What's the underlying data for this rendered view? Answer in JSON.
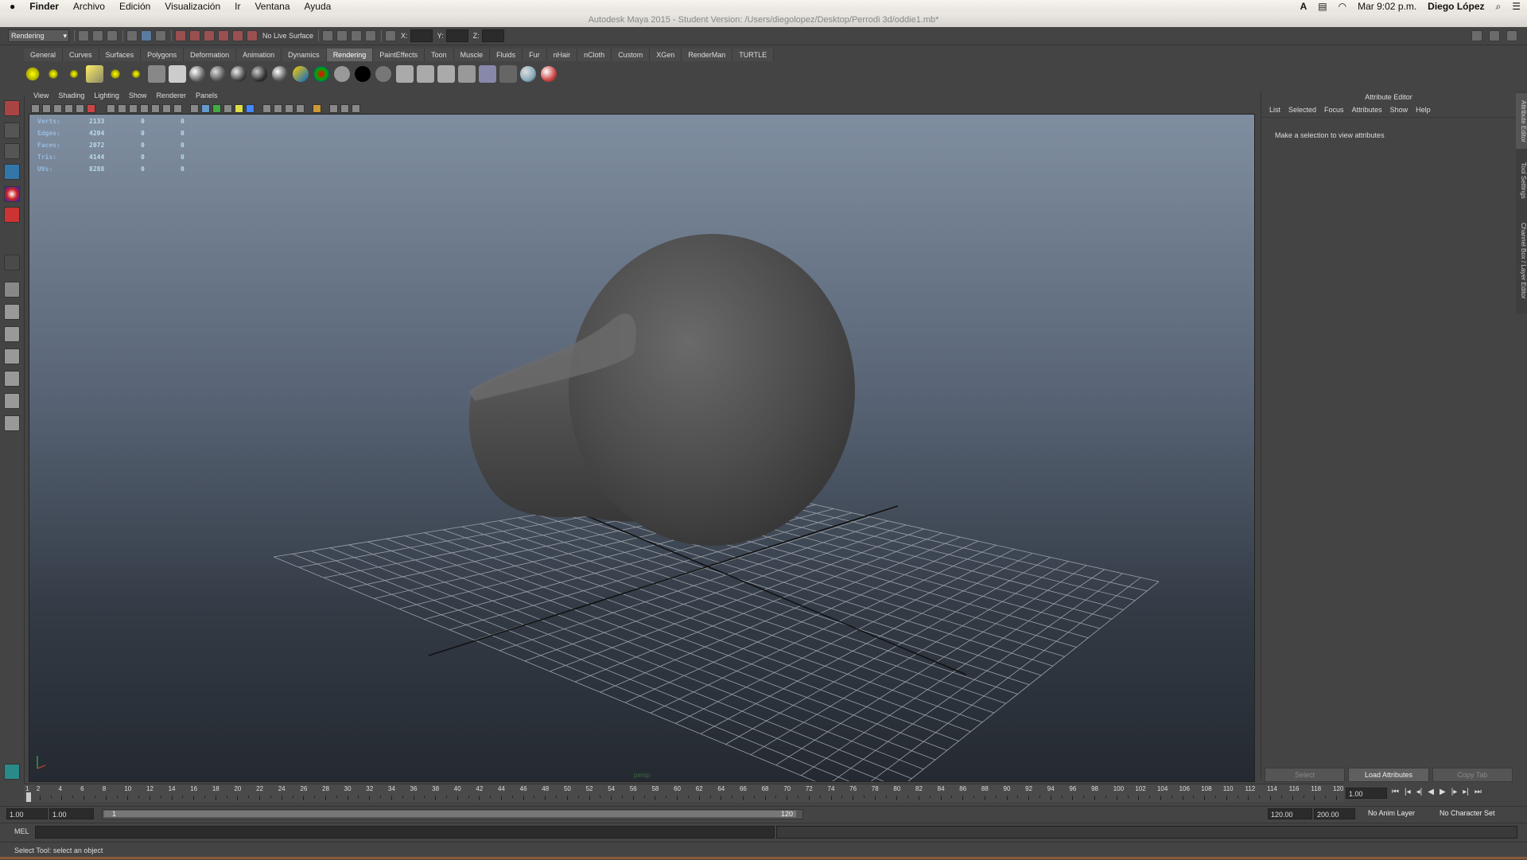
{
  "mac_menu": {
    "apple": "",
    "items": [
      "Finder",
      "Archivo",
      "Edición",
      "Visualización",
      "Ir",
      "Ventana",
      "Ayuda"
    ],
    "clock": "Mar 9:02 p.m.",
    "user": "Diego López"
  },
  "window": {
    "title": "Autodesk Maya 2015 - Student Version: /Users/diegolopez/Desktop/Perrodi 3d/oddie1.mb*"
  },
  "status_line": {
    "mode": "Rendering",
    "live_surface": "No Live Surface",
    "x_label": "X:",
    "y_label": "Y:",
    "z_label": "Z:"
  },
  "shelf_tabs": [
    "General",
    "Curves",
    "Surfaces",
    "Polygons",
    "Deformation",
    "Animation",
    "Dynamics",
    "Rendering",
    "PaintEffects",
    "Toon",
    "Muscle",
    "Fluids",
    "Fur",
    "nHair",
    "nCloth",
    "Custom",
    "XGen",
    "RenderMan",
    "TURTLE"
  ],
  "active_shelf_tab": "Rendering",
  "viewport": {
    "menu": [
      "View",
      "Shading",
      "Lighting",
      "Show",
      "Renderer",
      "Panels"
    ],
    "hud": [
      {
        "label": "Verts:",
        "a": "2133",
        "b": "0",
        "c": "0"
      },
      {
        "label": "Edges:",
        "a": "4204",
        "b": "0",
        "c": "0"
      },
      {
        "label": "Faces:",
        "a": "2072",
        "b": "0",
        "c": "0"
      },
      {
        "label": "Tris:",
        "a": "4144",
        "b": "0",
        "c": "0"
      },
      {
        "label": "UVs:",
        "a": "8288",
        "b": "0",
        "c": "0"
      }
    ],
    "camera_label": "persp"
  },
  "attribute_editor": {
    "title": "Attribute Editor",
    "menu": [
      "List",
      "Selected",
      "Focus",
      "Attributes",
      "Show",
      "Help"
    ],
    "message": "Make a selection to view attributes",
    "buttons": {
      "select": "Select",
      "load": "Load Attributes",
      "copy": "Copy Tab"
    },
    "side_tabs": [
      "Attribute Editor",
      "Tool Settings",
      "Channel Box / Layer Editor"
    ]
  },
  "timeline": {
    "start": 1,
    "end": 120,
    "current_frame": "1.00",
    "labels": [
      "1",
      "2",
      "4",
      "6",
      "8",
      "10",
      "12",
      "14",
      "16",
      "18",
      "20",
      "22",
      "24",
      "26",
      "28",
      "30",
      "32",
      "34",
      "36",
      "38",
      "40",
      "42",
      "44",
      "46",
      "48",
      "50",
      "52",
      "54",
      "56",
      "58",
      "60",
      "62",
      "64",
      "66",
      "68",
      "70",
      "72",
      "74",
      "76",
      "78",
      "80",
      "82",
      "84",
      "86",
      "88",
      "90",
      "92",
      "94",
      "96",
      "98",
      "100",
      "102",
      "104",
      "106",
      "108",
      "110",
      "112",
      "114",
      "116",
      "118",
      "120"
    ]
  },
  "range": {
    "start": "1.00",
    "playback_start": "1.00",
    "slider_start": "1",
    "slider_end": "120",
    "playback_end": "120.00",
    "end": "200.00",
    "anim_layer": "No Anim Layer",
    "char_set": "No Character Set"
  },
  "command": {
    "mel": "MEL"
  },
  "help_line": "Select Tool: select an object",
  "colors": {
    "viewport_top": "#7f8ea0",
    "viewport_bottom": "#252a31",
    "panel": "#444444"
  }
}
